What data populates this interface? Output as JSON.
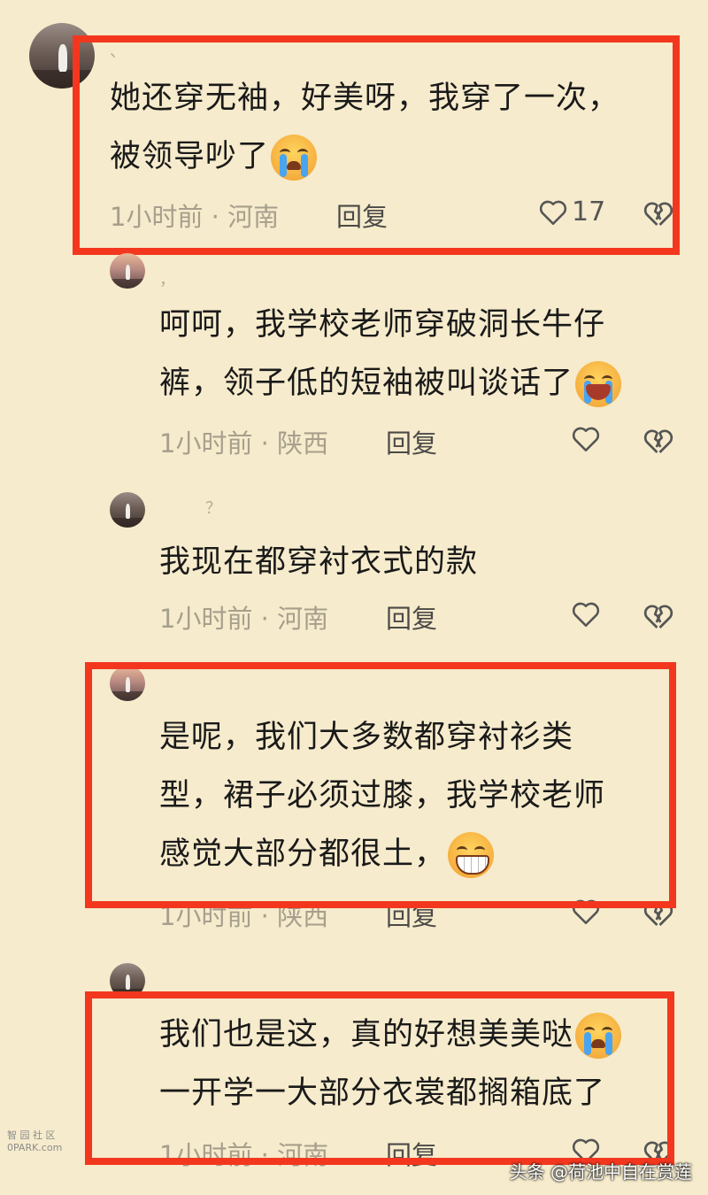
{
  "comments": [
    {
      "name": "、",
      "lines": [
        "她还穿无袖，好美呀，我穿了一次，",
        "被领导吵了"
      ],
      "emoji": "crying-face",
      "time": "1小时前",
      "separator": "·",
      "location": "河南",
      "reply_label": "回复",
      "likes": "17"
    },
    {
      "name": "，",
      "lines": [
        "呵呵，我学校老师穿破洞长牛仔",
        "裤，领子低的短袖被叫谈话了"
      ],
      "emoji": "laughing-face",
      "time": "1小时前",
      "separator": "·",
      "location": "陕西",
      "reply_label": "回复",
      "likes": ""
    },
    {
      "name": "？",
      "lines": [
        "我现在都穿衬衣式的款"
      ],
      "emoji": "",
      "time": "1小时前",
      "separator": "·",
      "location": "河南",
      "reply_label": "回复",
      "likes": ""
    },
    {
      "name": "",
      "lines": [
        "是呢，我们大多数都穿衬衫类",
        "型，裙子必须过膝，我学校老师",
        "感觉大部分都很土，"
      ],
      "emoji": "grinning-face",
      "time": "1小时前",
      "separator": "·",
      "location": "陕西",
      "reply_label": "回复",
      "likes": ""
    },
    {
      "name": "、",
      "lines": [
        "我们也是这，真的好想美美哒",
        "一开学一大部分衣裳都搁箱底了"
      ],
      "emoji": "crying-face",
      "time": "1小时前",
      "separator": "·",
      "location": "河南",
      "reply_label": "回复",
      "likes": ""
    }
  ],
  "watermark": {
    "site_logo_line1": "智 园 社 区",
    "site_logo_line2": "0PARK.com",
    "brand": "头条 @荷池中自在赏莲"
  },
  "colors": {
    "background": "#f6ebcc",
    "highlight_box": "#f3371f",
    "meta_text": "#a79f8d"
  }
}
